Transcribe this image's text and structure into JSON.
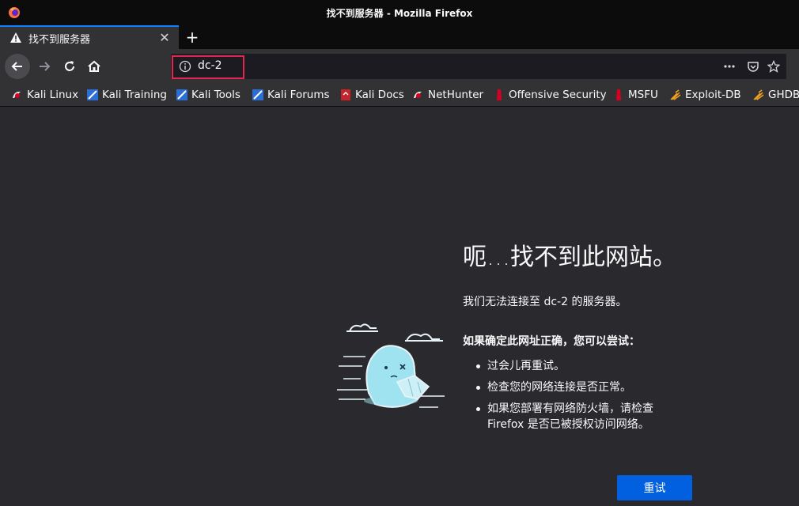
{
  "window": {
    "title": "找不到服务器 - Mozilla Firefox"
  },
  "tab": {
    "label": "找不到服务器",
    "icon": "warning-icon"
  },
  "toolbar": {
    "url": "dc-2"
  },
  "bookmarks": [
    {
      "label": "Kali Linux",
      "icon": "kali-dragon-icon"
    },
    {
      "label": "Kali Training",
      "icon": "kali-training-icon"
    },
    {
      "label": "Kali Tools",
      "icon": "kali-tools-icon"
    },
    {
      "label": "Kali Forums",
      "icon": "kali-forums-icon"
    },
    {
      "label": "Kali Docs",
      "icon": "kali-docs-icon"
    },
    {
      "label": "NetHunter",
      "icon": "nethunter-icon"
    },
    {
      "label": "Offensive Security",
      "icon": "offsec-icon"
    },
    {
      "label": "MSFU",
      "icon": "msfu-icon"
    },
    {
      "label": "Exploit-DB",
      "icon": "exploit-db-icon"
    },
    {
      "label": "GHDB",
      "icon": "ghdb-icon"
    }
  ],
  "error": {
    "title": "呃…找不到此网站。",
    "description": "我们无法连接至 dc-2 的服务器。",
    "try_heading": "如果确定此网址正确，您可以尝试：",
    "tips": [
      "过会儿再重试。",
      "检查您的网络连接是否正常。",
      "如果您部署有网络防火墙，请检查 Firefox 是否已被授权访问网络。"
    ],
    "retry_label": "重试"
  },
  "colors": {
    "accent": "#0a84ff",
    "button": "#0060df",
    "highlight": "#e22850",
    "background": "#2a2a2e"
  }
}
